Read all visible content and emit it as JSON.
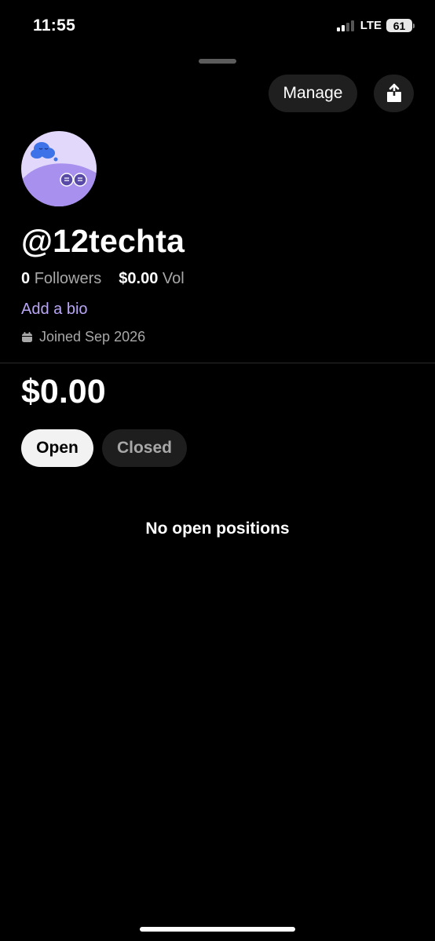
{
  "status_bar": {
    "time": "11:55",
    "network": "LTE",
    "battery": "61"
  },
  "header": {
    "manage_label": "Manage",
    "share_icon": "share-icon"
  },
  "profile": {
    "username": "@12techta",
    "followers_count": "0",
    "followers_label": "Followers",
    "volume_value": "$0.00",
    "volume_label": "Vol",
    "add_bio_label": "Add a bio",
    "joined_text": "Joined Sep 2026"
  },
  "portfolio": {
    "balance": "$0.00",
    "tabs": [
      {
        "label": "Open",
        "selected": true
      },
      {
        "label": "Closed",
        "selected": false
      }
    ],
    "empty_message": "No open positions"
  },
  "colors": {
    "background": "#000000",
    "accent": "#b9a6f5",
    "avatar_bg": "#d9ccf7",
    "button_bg": "#1f1f1f"
  }
}
